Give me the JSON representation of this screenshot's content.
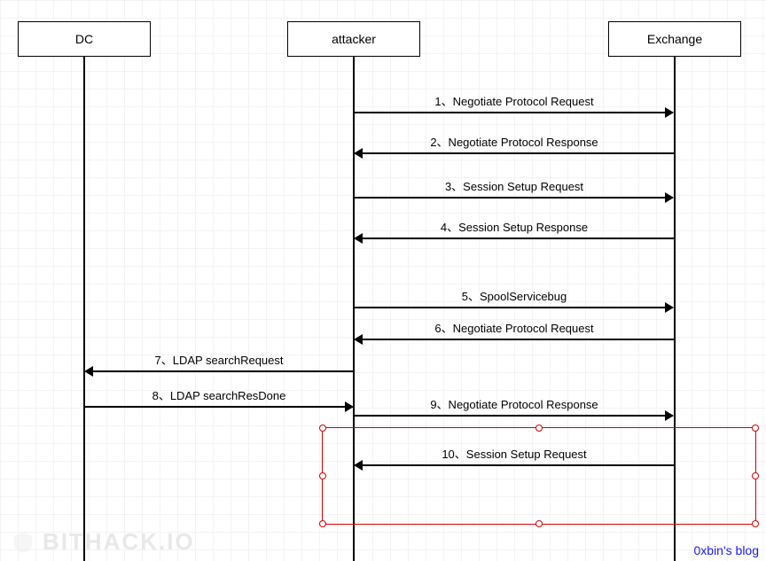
{
  "actors": {
    "dc": "DC",
    "attacker": "attacker",
    "exchange": "Exchange"
  },
  "messages": {
    "m1": "1、Negotiate Protocol Request",
    "m2": "2、Negotiate Protocol Response",
    "m3": "3、Session Setup Request",
    "m4": "4、Session Setup Response",
    "m5": "5、SpoolServicebug",
    "m6": "6、Negotiate Protocol Request",
    "m7": "7、LDAP searchRequest",
    "m8": "8、LDAP searchResDone",
    "m9": "9、Negotiate Protocol Response",
    "m10": "10、Session Setup Request"
  },
  "watermark": "BITHACK.IO",
  "credit": "0xbin's blog"
}
